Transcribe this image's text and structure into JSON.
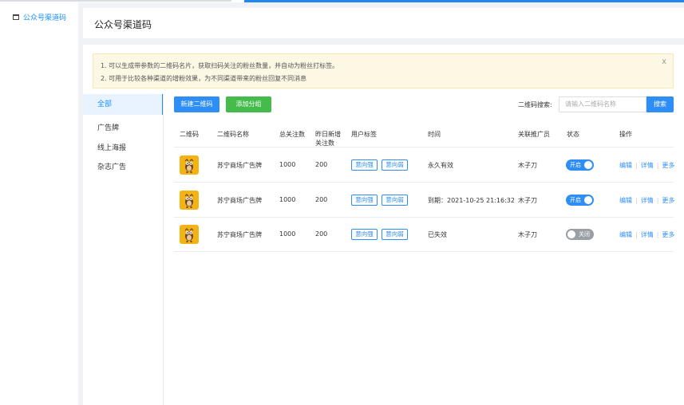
{
  "nav": {
    "item_label": "公众号渠道码"
  },
  "header": {
    "title": "公众号渠道码"
  },
  "notice": {
    "line1": "1. 可以生成带参数的二维码名片，获取扫码关注的粉丝数量，并自动为粉丝打标签。",
    "line2": "2. 可用于比较各种渠道的增粉效果，为不同渠道带来的粉丝回复不同消息",
    "close": "x"
  },
  "groups": [
    "全部",
    "广告牌",
    "线上海报",
    "杂志广告"
  ],
  "toolbar": {
    "new_label": "新建二维码",
    "add_group_label": "添加分组",
    "search_label": "二维码搜索:",
    "search_placeholder": "请输入二维码名称",
    "search_button": "搜索"
  },
  "table": {
    "headers": {
      "qr": "二维码",
      "name": "二维码名称",
      "total": "总关注数",
      "new1": "昨日新增",
      "new2": "关注数",
      "tags": "用户标签",
      "time": "时间",
      "promoter": "关联推广员",
      "status": "状态",
      "ops": "操作"
    },
    "rows": [
      {
        "name": "苏宁商场广告牌",
        "total": "1000",
        "new": "200",
        "tag1": "意向强",
        "tag2": "意向弱",
        "time": "永久有效",
        "promoter": "木子刀",
        "status": "开启",
        "on": true
      },
      {
        "name": "苏宁商场广告牌",
        "total": "1000",
        "new": "200",
        "tag1": "意向强",
        "tag2": "意向弱",
        "time": "到期：2021-10-25 21:16:32",
        "promoter": "木子刀",
        "status": "开启",
        "on": true
      },
      {
        "name": "苏宁商场广告牌",
        "total": "1000",
        "new": "200",
        "tag1": "意向强",
        "tag2": "意向弱",
        "time": "已失效",
        "promoter": "木子刀",
        "status": "关闭",
        "on": false
      }
    ],
    "ops": {
      "edit": "编辑",
      "detail": "详情",
      "more": "更多"
    }
  },
  "colors": {
    "primary": "#2e8ef5",
    "green": "#45bb4b",
    "notice_bg": "#fdf8e4",
    "qr_bg": "#f3b315"
  }
}
